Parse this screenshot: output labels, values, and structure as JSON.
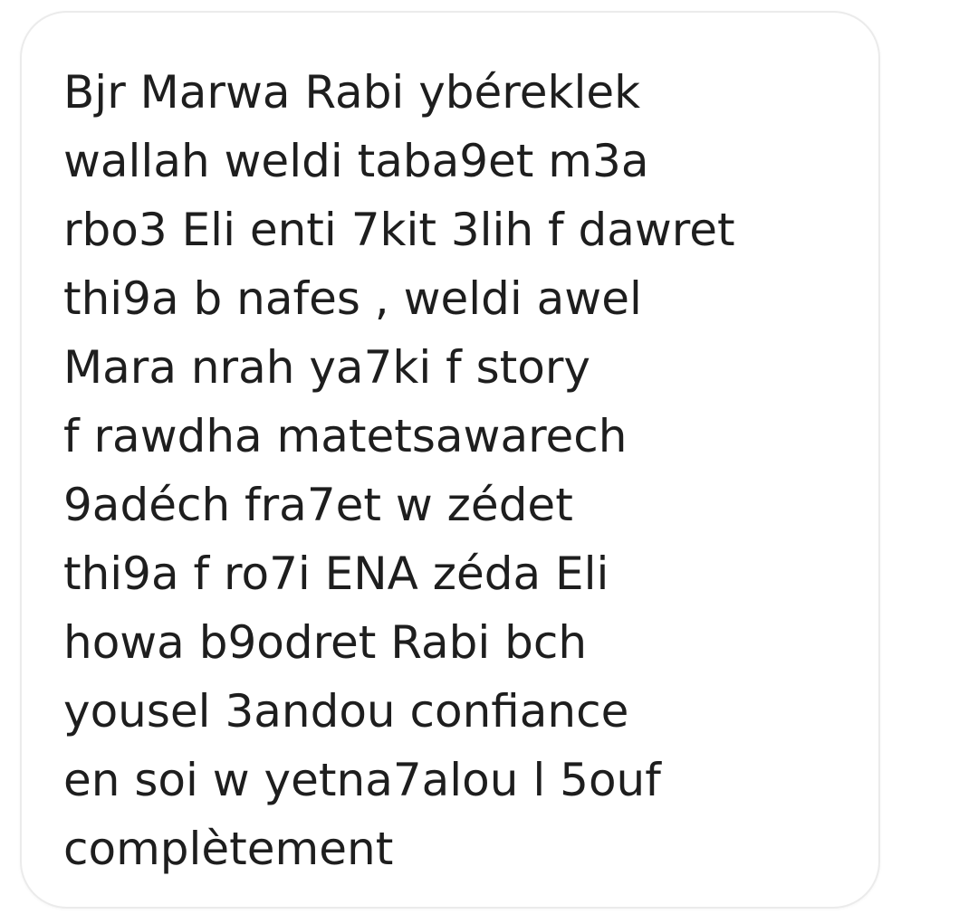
{
  "message": {
    "lines": [
      "Bjr Marwa Rabi ybéreklek",
      "wallah weldi taba9et m3a",
      "rbo3 Eli enti 7kit 3lih f dawret",
      "thi9a b nafes , weldi awel",
      "Mara nrah ya7ki f story",
      "f rawdha matetsawarech",
      "9adéch fra7et w zédet",
      "thi9a f ro7i ENA zéda Eli",
      "howa b9odret Rabi bch",
      "yousel 3andou confiance",
      "en soi w yetna7alou l 5ouf",
      "complètement"
    ]
  },
  "colors": {
    "background": "#ffffff",
    "bubble_border": "#ebebeb",
    "text": "#1e1e1e"
  }
}
